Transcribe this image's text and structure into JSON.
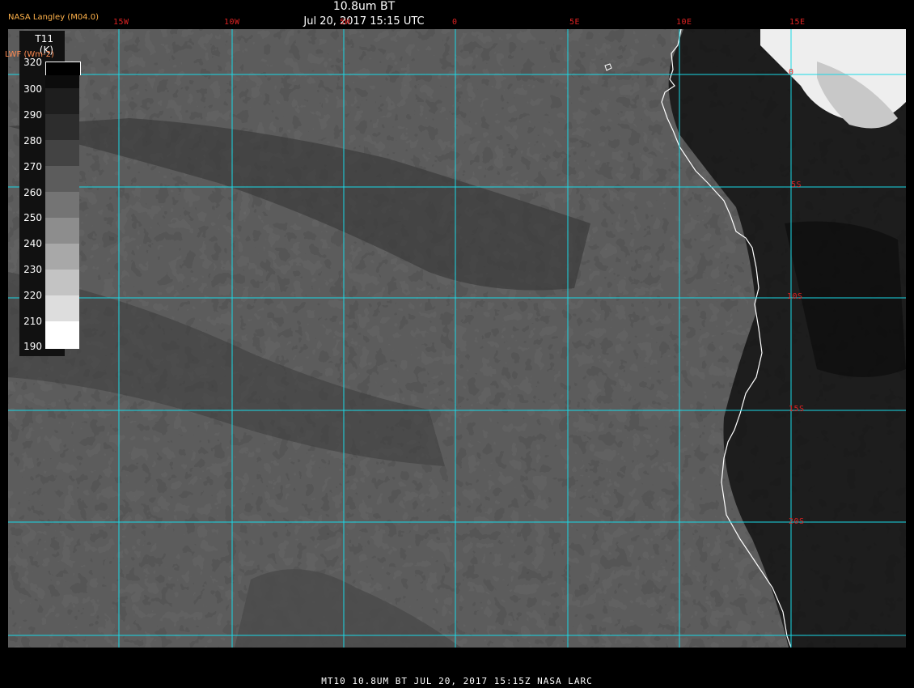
{
  "header": {
    "title_line1": "10.8um BT",
    "title_line2": "Jul 20, 2017 15:15 UTC",
    "provider": "NASA Langley (M04.0)"
  },
  "colorbar": {
    "variable": "T11",
    "units": "(K)",
    "overlay_label": "LWF (Wm-2)",
    "ticks": [
      "320",
      "300",
      "290",
      "280",
      "270",
      "260",
      "250",
      "240",
      "230",
      "220",
      "210",
      "190"
    ]
  },
  "grid": {
    "longitude_labels": [
      "15W",
      "10W",
      "5W",
      "0",
      "5E",
      "10E",
      "15E"
    ],
    "latitude_labels": [
      "0",
      "5S",
      "10S",
      "15S",
      "20S"
    ],
    "line_color": "#19d9e6"
  },
  "footer": {
    "text": "MT10  10.8UM BT   JUL 20, 2017 15:15Z  NASA LARC"
  },
  "colors": {
    "grid": "#19d9e6",
    "label": "#d22222",
    "coast": "#ffffff",
    "provider": "#ffb24a"
  }
}
